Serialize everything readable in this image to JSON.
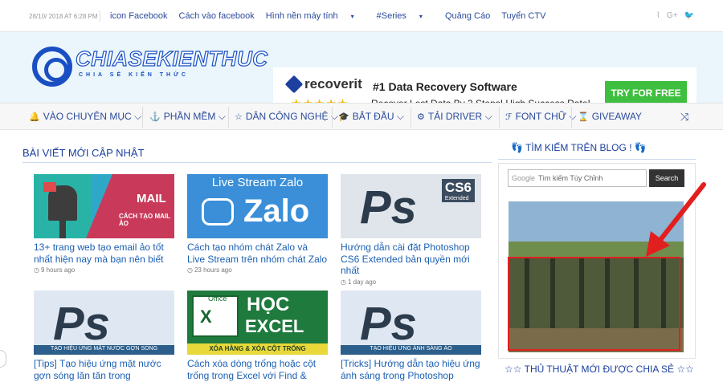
{
  "topbar": {
    "date": "28/10/ 2018 AT 6:28 PM",
    "links": [
      "icon Facebook",
      "Cách vào facebook",
      "Hình nền máy tính",
      "#Series",
      "Quảng Cáo",
      "Tuyển CTV"
    ],
    "social_icons": [
      "rss-icon",
      "google-plus-icon",
      "twitter-icon"
    ]
  },
  "header": {
    "brand": "CHIASEKIENTHUC",
    "tagline": "CHIA SẺ KIẾN THỨC",
    "ad": {
      "logo": "recoverit",
      "stars": "★★★★★",
      "headline": "#1 Data Recovery Software",
      "subline": "Recover Lost Data By 3 Steps! High Success Rate!",
      "cta": "TRY FOR FREE"
    }
  },
  "nav": [
    {
      "icon": "bell-icon",
      "glyph": "🔔",
      "label": "VÀO CHUYÊN MỤC",
      "caret": "⌵"
    },
    {
      "icon": "anchor-icon",
      "glyph": "⚓",
      "label": "PHẦN MỀM",
      "caret": "⌵"
    },
    {
      "icon": "star-icon",
      "glyph": "☆",
      "label": "DÂN CÔNG NGHỆ",
      "caret": "⌵"
    },
    {
      "icon": "graduation-cap-icon",
      "glyph": "🎓",
      "label": "BẮT ĐẦU",
      "caret": "⌵"
    },
    {
      "icon": "cogs-icon",
      "glyph": "⚙",
      "label": "TẢI DRIVER",
      "caret": "⌵"
    },
    {
      "icon": "font-icon",
      "glyph": "ℱ",
      "label": "FONT CHỮ",
      "caret": "⌵"
    },
    {
      "icon": "hourglass-icon",
      "glyph": "⌛",
      "label": "GIVEAWAY",
      "caret": ""
    }
  ],
  "main": {
    "section_title": "BÀI VIẾT MỚI CẬP NHẬT",
    "posts": [
      {
        "title": "13+ trang web tạo email ảo tốt nhất hiện nay mà bạn nên biết",
        "time": "9 hours ago",
        "thumb_text": "MAIL",
        "thumb_sub": "CÁCH TẠO MAIL ẢO"
      },
      {
        "title": "Cách tạo nhóm chát Zalo và Live Stream trên nhóm chát Zalo",
        "time": "23 hours ago",
        "thumb_text": "Live Stream Zalo",
        "thumb_sub": "Zalo"
      },
      {
        "title": "Hướng dẫn cài đặt Photoshop CS6 Extended bản quyền mới nhất",
        "time": "1 day ago",
        "thumb_text": "CS6",
        "thumb_sub": "Extended"
      },
      {
        "title": "[Tips] Tạo hiệu ứng mặt nước gợn sóng lăn tăn trong",
        "time": "",
        "thumb_text": "TẠO HIỆU ỨNG MẶT NƯỚC GỢN SÓNG",
        "thumb_sub": ""
      },
      {
        "title": "Cách xóa dòng trống hoặc cột trống trong Excel với Find &",
        "time": "",
        "thumb_text": "HỌC",
        "thumb_sub": "EXCEL"
      },
      {
        "title": "[Tricks] Hướng dẫn tạo hiệu ứng ánh sáng trong Photoshop",
        "time": "",
        "thumb_text": "TẠO HIỆU ỨNG ÁNH SÁNG ẢO",
        "thumb_sub": ""
      }
    ],
    "excel_office": "Office",
    "excel_band": "XÓA HÀNG & XÓA CỘT TRỐNG"
  },
  "sidebar": {
    "search_title": "👣 TÌM KIẾM TRÊN BLOG ! 👣",
    "search_google": "Google",
    "search_placeholder": "Tìm kiếm Tùy Chỉnh",
    "search_button": "Search",
    "tips_title": "☆☆ THỦ THUẬT MỚI ĐƯỢC CHIA SẺ ☆☆"
  },
  "colors": {
    "accent": "#1a4fc4",
    "link": "#1a5fb4",
    "cta": "#3fbf3f",
    "highlight": "#e21f1f"
  }
}
